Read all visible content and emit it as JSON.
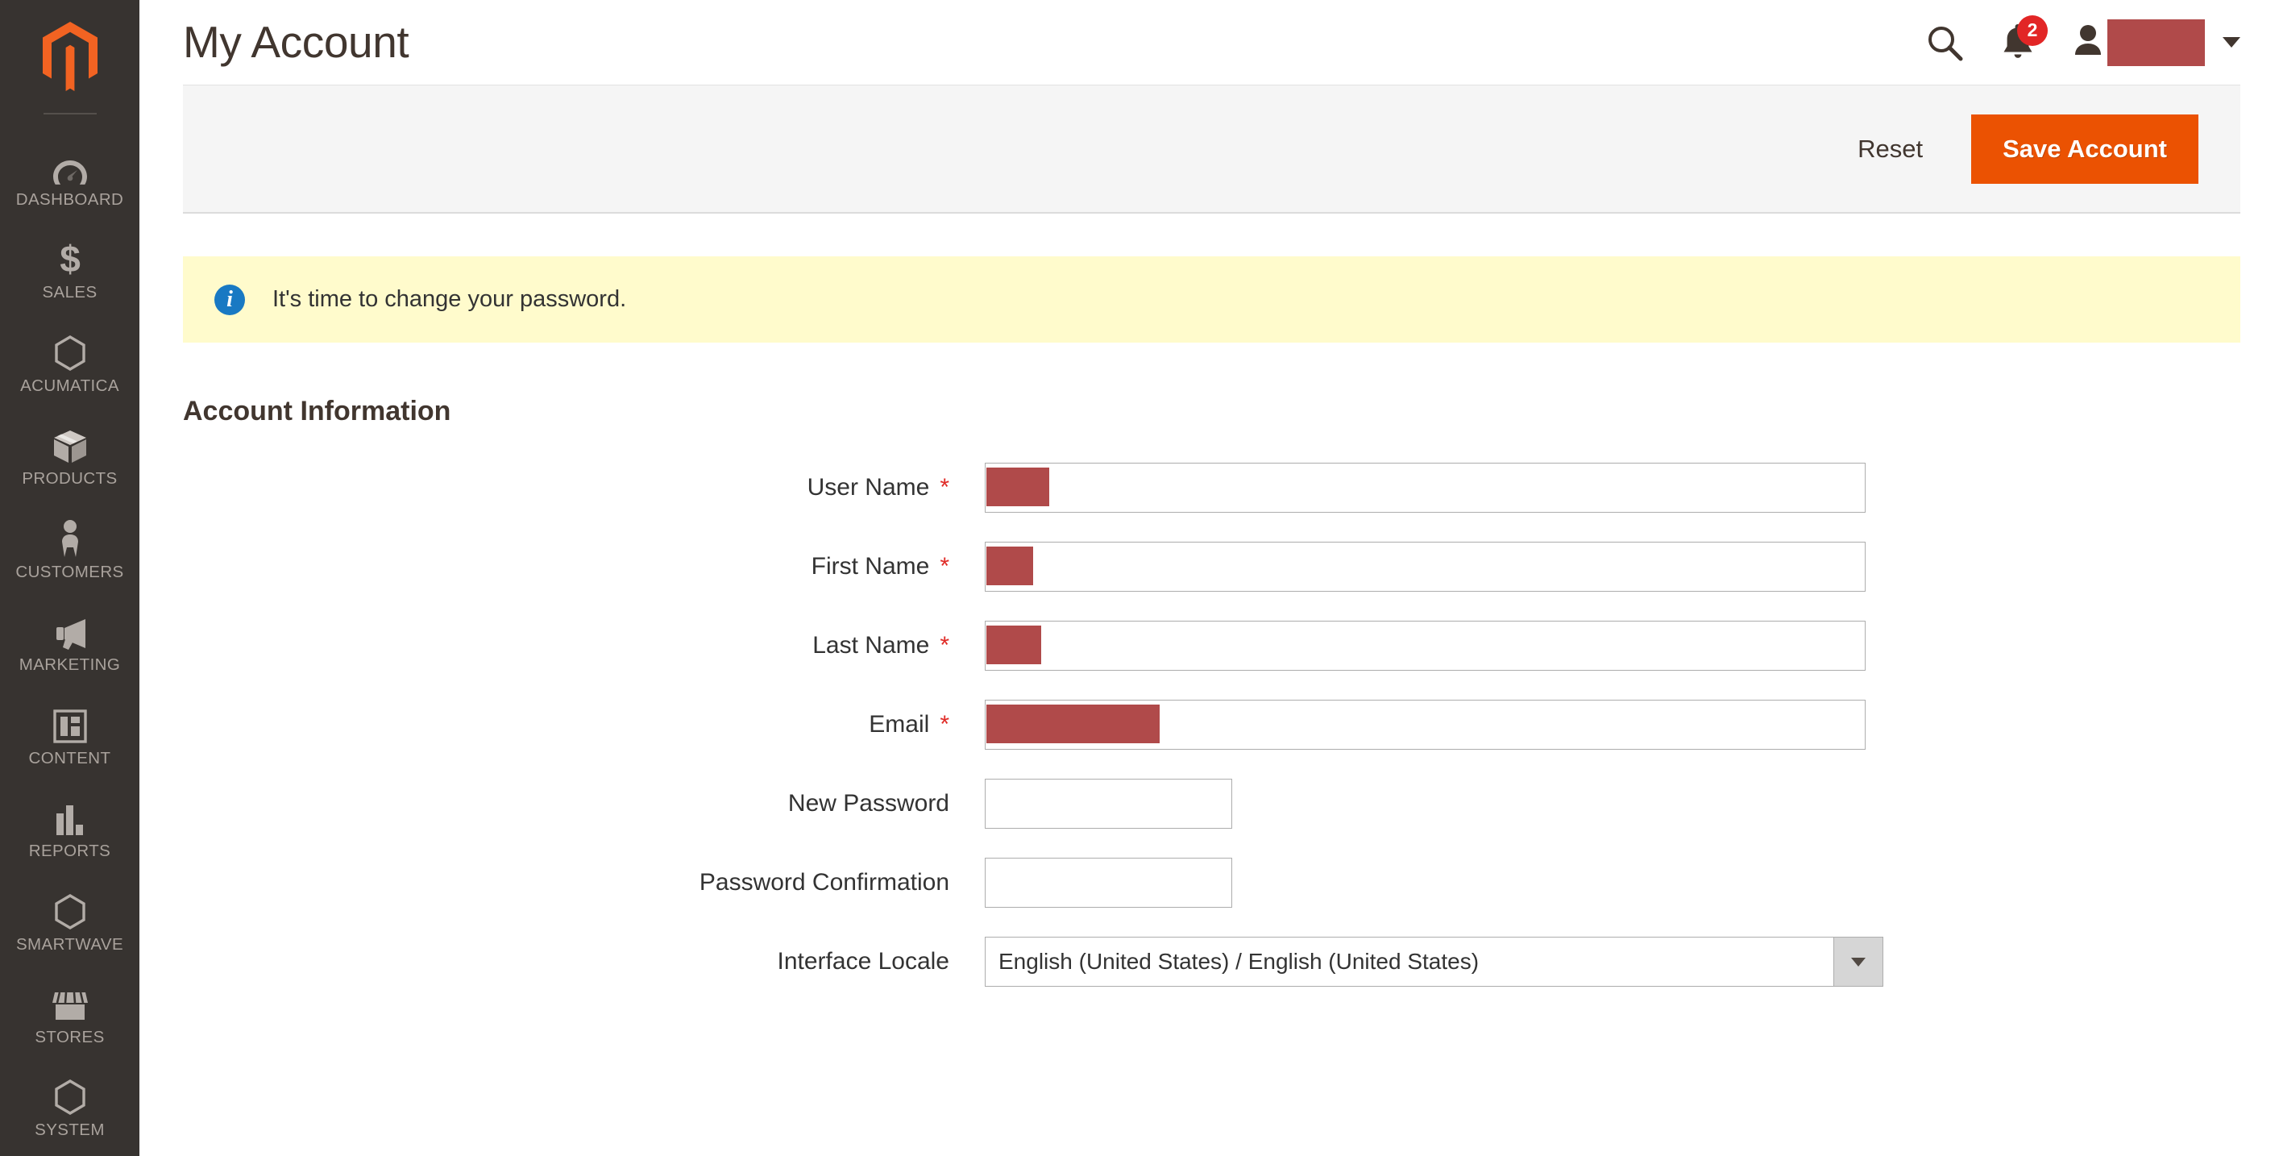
{
  "theme": {
    "sidebar_bg": "#373330",
    "accent_orange": "#eb5202",
    "badge_red": "#e22626",
    "notice_bg": "#fffbcc",
    "info_blue": "#1979c3",
    "redaction": "#b04a4a"
  },
  "sidebar": {
    "logo": "magento-logo-icon",
    "items": [
      {
        "label": "Dashboard",
        "icon": "dashboard-gauge-icon"
      },
      {
        "label": "Sales",
        "icon": "dollar-sign-icon"
      },
      {
        "label": "Acumatica",
        "icon": "hexagon-icon"
      },
      {
        "label": "Products",
        "icon": "box-icon"
      },
      {
        "label": "Customers",
        "icon": "person-icon"
      },
      {
        "label": "Marketing",
        "icon": "megaphone-icon"
      },
      {
        "label": "Content",
        "icon": "layout-panel-icon"
      },
      {
        "label": "Reports",
        "icon": "bar-chart-icon"
      },
      {
        "label": "Smartwave",
        "icon": "hexagon-icon"
      },
      {
        "label": "Stores",
        "icon": "storefront-icon"
      },
      {
        "label": "System",
        "icon": "hexagon-icon"
      }
    ]
  },
  "header": {
    "title": "My Account",
    "search_icon": "search-icon",
    "notifications_icon": "bell-icon",
    "notifications_count": "2",
    "user_icon": "user-avatar-icon",
    "user_name_redacted": "",
    "user_menu_caret": "chevron-down-icon"
  },
  "page_actions": {
    "reset_label": "Reset",
    "save_label": "Save Account"
  },
  "notice": {
    "icon": "info-icon",
    "message": "It's time to change your password."
  },
  "form": {
    "section_title": "Account Information",
    "required_marker": "*",
    "fields": [
      {
        "label": "User Name",
        "required": true,
        "value": "",
        "redacted": true,
        "redact_width": 78,
        "control": "text"
      },
      {
        "label": "First Name",
        "required": true,
        "value": "",
        "redacted": true,
        "redact_width": 58,
        "control": "text"
      },
      {
        "label": "Last Name",
        "required": true,
        "value": "",
        "redacted": true,
        "redact_width": 68,
        "control": "text"
      },
      {
        "label": "Email",
        "required": true,
        "value": "",
        "redacted": true,
        "redact_width": 215,
        "control": "text"
      },
      {
        "label": "New Password",
        "required": false,
        "value": "",
        "redacted": false,
        "redact_width": 0,
        "control": "password"
      },
      {
        "label": "Password Confirmation",
        "required": false,
        "value": "",
        "redacted": false,
        "redact_width": 0,
        "control": "password"
      }
    ],
    "locale": {
      "label": "Interface Locale",
      "value": "English (United States) / English (United States)",
      "caret_icon": "chevron-down-icon"
    }
  }
}
